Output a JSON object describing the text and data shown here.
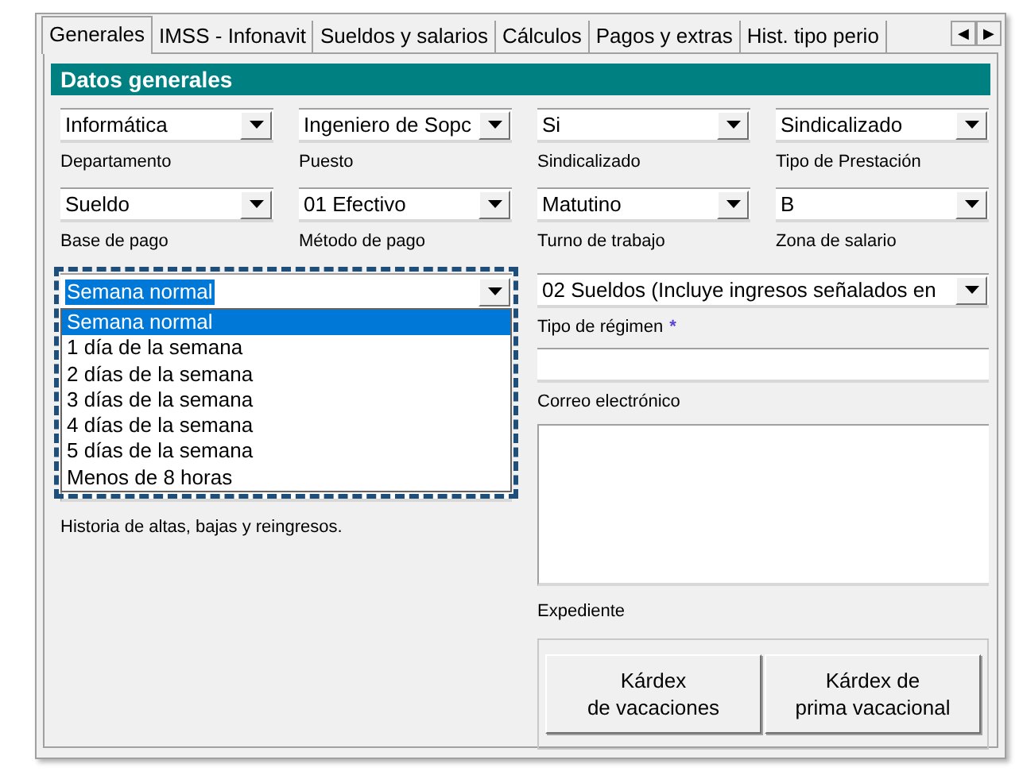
{
  "tabs": [
    {
      "label": "Generales",
      "selected": true
    },
    {
      "label": "IMSS - Infonavit",
      "selected": false
    },
    {
      "label": "Sueldos y salarios",
      "selected": false
    },
    {
      "label": "Cálculos",
      "selected": false
    },
    {
      "label": "Pagos y extras",
      "selected": false
    },
    {
      "label": "Hist. tipo perio",
      "selected": false
    }
  ],
  "tab_scroll": [
    "◀",
    "▶"
  ],
  "section_title": "Datos generales",
  "combos": [
    {
      "value": "Informática",
      "label": "Departamento"
    },
    {
      "value": "Ingeniero de Sopc",
      "label": "Puesto"
    },
    {
      "value": "Si",
      "label": "Sindicalizado"
    },
    {
      "value": "Sindicalizado",
      "label": "Tipo de Prestación"
    },
    {
      "value": "Sueldo",
      "label": "Base de pago"
    },
    {
      "value": "01 Efectivo",
      "label": "Método de pago"
    },
    {
      "value": "Matutino",
      "label": "Turno de trabajo"
    },
    {
      "value": "B",
      "label": "Zona de salario"
    }
  ],
  "open_combo": {
    "value": "Semana normal",
    "options": [
      {
        "label": "Semana normal",
        "selected": true
      },
      {
        "label": "1 día de la semana",
        "selected": false
      },
      {
        "label": "2 días de la semana",
        "selected": false
      },
      {
        "label": "3 días de la semana",
        "selected": false
      },
      {
        "label": "4 días de la semana",
        "selected": false
      },
      {
        "label": "5 días de la semana",
        "selected": false
      },
      {
        "label": "Menos de 8 horas",
        "selected": false
      }
    ]
  },
  "regimen": {
    "value": "02 Sueldos (Incluye ingresos señalados en",
    "label": "Tipo de régimen",
    "required_mark": "*"
  },
  "email": {
    "label": "Correo electrónico"
  },
  "history": {
    "label": "Historia de altas, bajas y reingresos."
  },
  "expediente": {
    "label": "Expediente"
  },
  "buttons": [
    [
      "Kárdex",
      "de vacaciones"
    ],
    [
      "Kárdex de",
      "prima vacacional"
    ]
  ]
}
